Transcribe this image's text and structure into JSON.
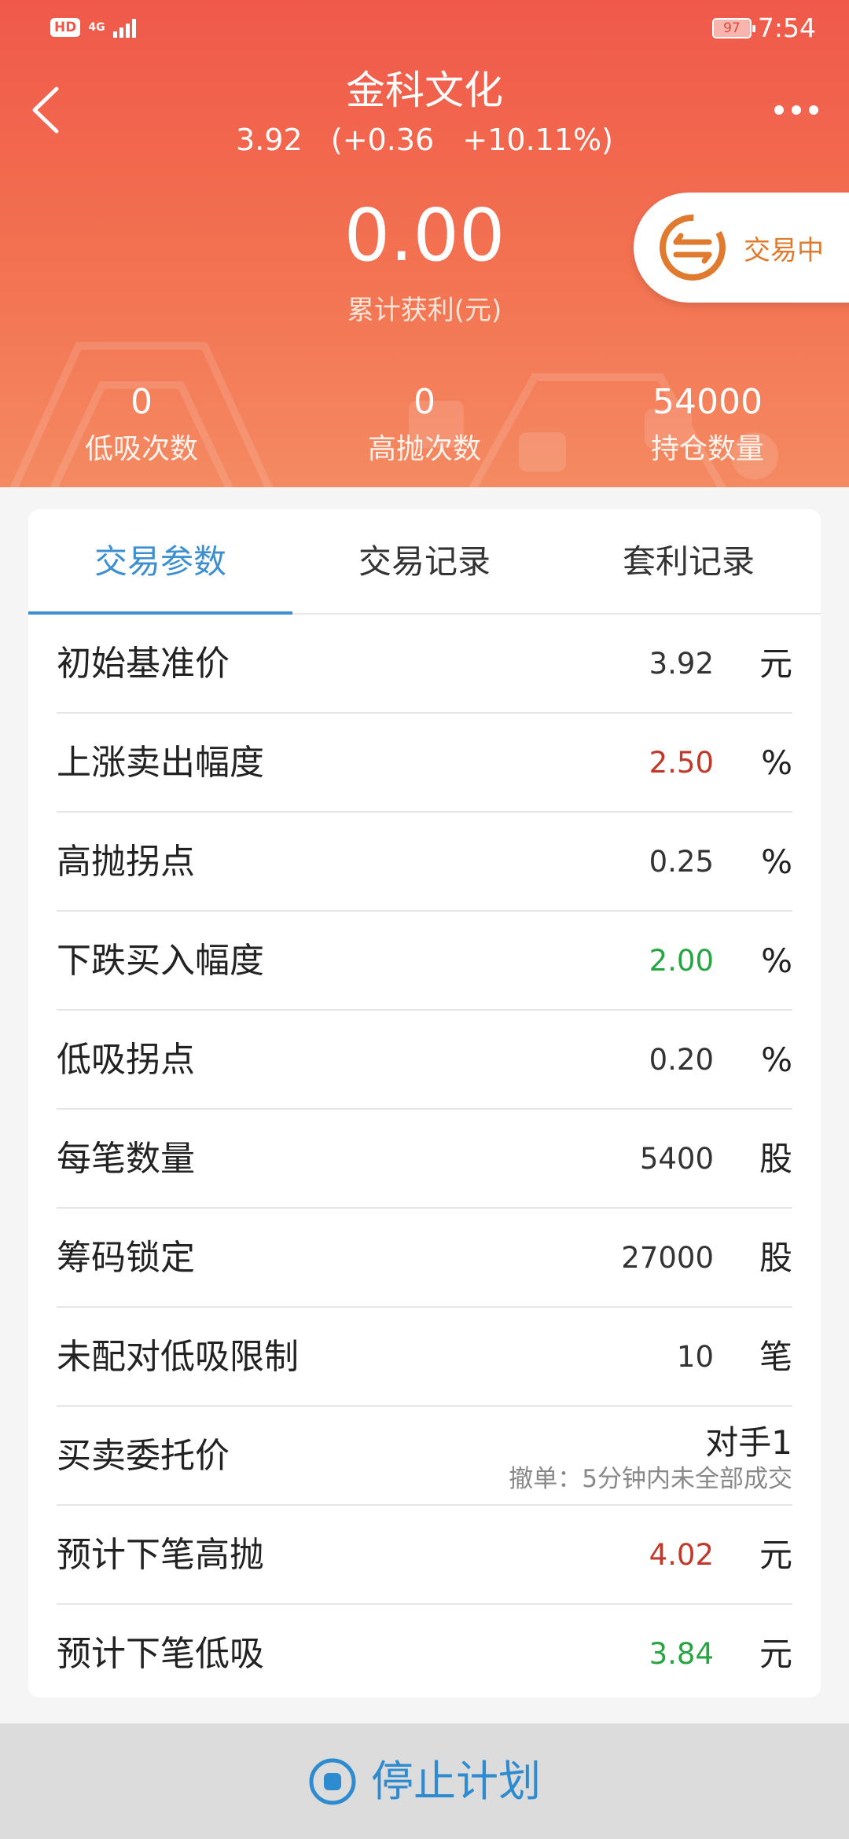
{
  "status_bar": {
    "hd_badge": "HD",
    "network": "4G",
    "battery": "97",
    "time": "7:54"
  },
  "header": {
    "title": "金科文化",
    "quote": "3.92   (+0.36   +10.11%)",
    "profit_value": "0.00",
    "profit_label": "累计获利(元)",
    "status_pill_label": "交易中",
    "stats": [
      {
        "value": "0",
        "label": "低吸次数"
      },
      {
        "value": "0",
        "label": "高抛次数"
      },
      {
        "value": "54000",
        "label": "持仓数量"
      }
    ]
  },
  "tabs": [
    {
      "label": "交易参数",
      "active": true
    },
    {
      "label": "交易记录",
      "active": false
    },
    {
      "label": "套利记录",
      "active": false
    }
  ],
  "params": {
    "initial_price": {
      "label": "初始基准价",
      "value": "3.92",
      "unit": "元"
    },
    "rise_sell": {
      "label": "上涨卖出幅度",
      "value": "2.50",
      "unit": "%"
    },
    "high_turn": {
      "label": "高抛拐点",
      "value": "0.25",
      "unit": "%"
    },
    "fall_buy": {
      "label": "下跌买入幅度",
      "value": "2.00",
      "unit": "%"
    },
    "low_turn": {
      "label": "低吸拐点",
      "value": "0.20",
      "unit": "%"
    },
    "per_qty": {
      "label": "每笔数量",
      "value": "5400",
      "unit": "股"
    },
    "chip_lock": {
      "label": "筹码锁定",
      "value": "27000",
      "unit": "股"
    },
    "unpaired_limit": {
      "label": "未配对低吸限制",
      "value": "10",
      "unit": "笔"
    },
    "order_price": {
      "label": "买卖委托价",
      "value": "对手1",
      "sub": "撤单：5分钟内未全部成交"
    },
    "next_high": {
      "label": "预计下笔高抛",
      "value": "4.02",
      "unit": "元"
    },
    "next_low": {
      "label": "预计下笔低吸",
      "value": "3.84",
      "unit": "元"
    }
  },
  "bottom": {
    "stop_label": "停止计划"
  },
  "colors": {
    "header_top": "#f0594a",
    "accent_blue": "#3d8fd0",
    "rise_red": "#c0392b",
    "fall_green": "#27a543",
    "pill_orange": "#e07a2e"
  },
  "icons": [
    "back-icon",
    "more-icon",
    "swap-icon",
    "stop-circle-icon",
    "signal-icon",
    "battery-icon"
  ]
}
